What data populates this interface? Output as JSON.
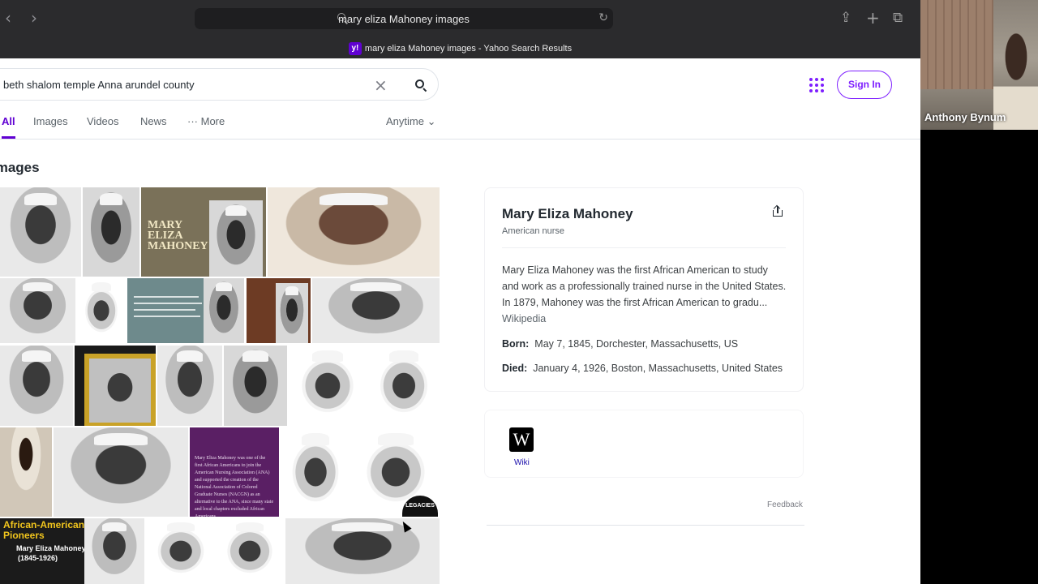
{
  "browser": {
    "address_text": "mary eliza Mahoney images",
    "tab_title": "mary eliza Mahoney images - Yahoo Search Results",
    "favicon_letter": "y!"
  },
  "search": {
    "query": "beth shalom temple Anna arundel county"
  },
  "header": {
    "signin_label": "Sign In"
  },
  "tabs": [
    {
      "label": "All",
      "active": true
    },
    {
      "label": "Images"
    },
    {
      "label": "Videos"
    },
    {
      "label": "News"
    },
    {
      "label": "More"
    }
  ],
  "time_filter": "Anytime",
  "section_title": "Images",
  "grid_text": {
    "banner": "MARY ELIZA MAHONEY",
    "purple_card": "Mary Eliza Mahoney was one of the first African Americans to join the American Nursing Association (ANA) and supported the creation of the National Association of Colored Graduate Nurses (NACGN) as an alternative to the ANA, since many state and local chapters excluded African Americans.",
    "pioneers_title": "African-American Health Pioneers",
    "pioneers_name": "Mary Eliza Mahoney",
    "pioneers_years": "(1845-1926)",
    "legacies": "LEGACIES"
  },
  "knowledge_panel": {
    "title": "Mary Eliza Mahoney",
    "subtitle": "American nurse",
    "description": "Mary Eliza Mahoney was the first African American to study and work as a professionally trained nurse in the United States. In 1879, Mahoney was the first African American to gradu...",
    "source_link": "Wikipedia",
    "born_label": "Born:",
    "born_value": "May 7, 1845, Dorchester, Massachusetts, US",
    "died_label": "Died:",
    "died_value": "January 4, 1926, Boston, Massachusetts, United States",
    "wiki_label": "Wiki",
    "wiki_logo": "W",
    "feedback": "Feedback"
  },
  "video_overlay": {
    "participant_name": "Anthony Bynum"
  },
  "colors": {
    "brand_purple": "#6001d2",
    "accent_purple": "#7e1fff",
    "chrome_dark": "#2b2b2d"
  }
}
